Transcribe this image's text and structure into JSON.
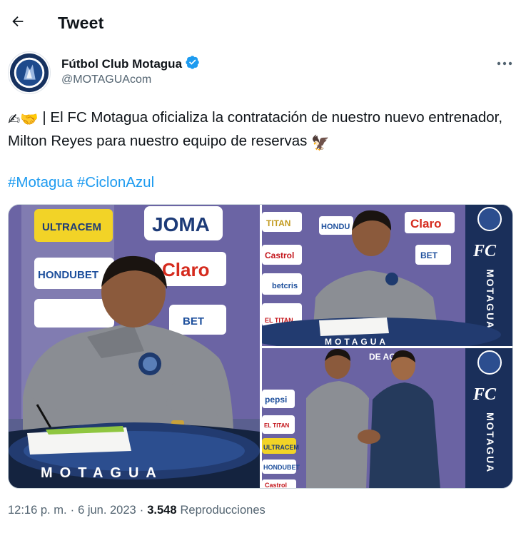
{
  "header": {
    "title": "Tweet"
  },
  "author": {
    "name": "Fútbol Club Motagua",
    "handle": "@MOTAGUAcom",
    "verified": true,
    "badge_color": "#1d9bf0",
    "avatar_text": "MOTAGUA",
    "avatar_subtext": "HONDURAS"
  },
  "tweet": {
    "emoji_lead": "✍🤝",
    "text": " | El FC Motagua oficializa la contratación de nuestro nuevo entrenador, Milton Reyes para nuestro equipo de reservas ",
    "emoji_trail": "🦅",
    "hashtags": [
      "#Motagua",
      "#CiclonAzul"
    ],
    "link_color": "#1d9bf0"
  },
  "media": {
    "photo_1": {
      "sponsors": [
        "ULTRACEM",
        "JOMA",
        "HONDUBET",
        "Claro",
        "BET"
      ],
      "banner_text": "MOTAGUA"
    },
    "photo_2": {
      "sponsors": [
        "TITAN",
        "HONDU",
        "Claro",
        "Castrol",
        "betcris",
        "EL TITAN",
        "BET"
      ],
      "side_text": "FC",
      "side_vertical": "MOTAGUA",
      "banner_text": "MOTAGUA"
    },
    "photo_3": {
      "sponsors": [
        "pepsi",
        "EL TITAN",
        "ULTRACEM",
        "HONDUBET",
        "Castrol"
      ],
      "top_text": "DE AGOS",
      "side_text": "FC",
      "side_vertical": "MOTAGUA"
    }
  },
  "meta": {
    "time": "12:16 p. m.",
    "separator": "·",
    "date": "6 jun. 2023",
    "views_count": "3.548",
    "views_label": "Reproducciones"
  }
}
